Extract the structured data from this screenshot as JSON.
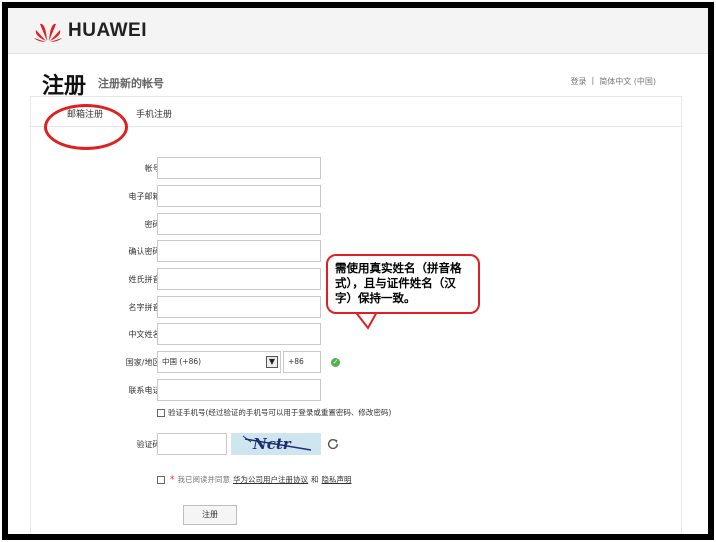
{
  "brand": {
    "name": "HUAWEI",
    "logo_icon": "huawei-logo-icon",
    "logo_color": "#e02020"
  },
  "page": {
    "title": "注册",
    "subtitle": "注册新的帐号"
  },
  "top_links": {
    "login": "登录",
    "separator": "|",
    "language": "简体中文 (中国)"
  },
  "tabs": [
    {
      "label": "邮箱注册",
      "active": true
    },
    {
      "label": "手机注册",
      "active": false
    }
  ],
  "form": {
    "required_mark": "*",
    "fields": [
      {
        "label": "帐号",
        "value": ""
      },
      {
        "label": "电子邮箱",
        "value": ""
      },
      {
        "label": "密码",
        "value": ""
      },
      {
        "label": "确认密码",
        "value": ""
      },
      {
        "label": "姓氏拼音",
        "value": ""
      },
      {
        "label": "名字拼音",
        "value": ""
      },
      {
        "label": "中文姓名",
        "value": ""
      }
    ],
    "country": {
      "label": "国家/地区",
      "selected": "中国 (+86)",
      "code": "+86",
      "valid_icon": "check-circle-icon"
    },
    "phone": {
      "label": "联系电话",
      "value": ""
    },
    "verify_phone_text": "验证手机号(经过验证的手机号可以用于登录或重置密码、修改密码)",
    "captcha": {
      "label": "验证码",
      "value": "",
      "image_text": "Nctr",
      "refresh_icon": "refresh-icon"
    },
    "agreement": {
      "prefix": "我已阅读并同意",
      "link1": "华为公司用户注册协议",
      "and": "和",
      "link2": "隐私声明"
    },
    "submit_label": "注册"
  },
  "annotation": {
    "bubble_text": "需使用真实姓名（拼音格式），且与证件姓名（汉字）保持一致。",
    "color": "#e02020"
  }
}
